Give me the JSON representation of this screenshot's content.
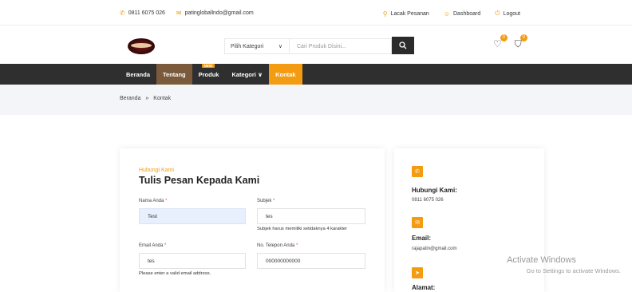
{
  "topbar": {
    "phone": "0811 6075 026",
    "email": "patingloballndo@gmail.com",
    "track": "Lacak Pesanan",
    "dashboard": "Dashboard",
    "logout": "Logout"
  },
  "header": {
    "category_label": "Pilih Kategori",
    "search_placeholder": "Cari Produk Disini...",
    "wishlist_count": "0",
    "cart_count": "0"
  },
  "nav": {
    "items": [
      "Beranda",
      "Tentang",
      "Produk",
      "Kategori ∨",
      "Kontak"
    ],
    "new_badge": "NEW"
  },
  "breadcrumb": {
    "home": "Beranda",
    "sep": "»",
    "current": "Kontak"
  },
  "form": {
    "subtitle": "Hubungi Kami",
    "title": "Tulis Pesan Kepada Kami",
    "name_label": "Nama Anda",
    "name_value": "Test",
    "subject_label": "Subjek",
    "subject_value": "tes",
    "subject_help": "Subjek harus memiliki setidaknya 4 karakter",
    "email_label": "Email Anda",
    "email_value": "tes",
    "email_help": "Please enter a valid email address.",
    "phone_label": "No. Telepon Anda",
    "phone_value": "000000000000",
    "required_mark": "*"
  },
  "info": {
    "phone_head": "Hubungi Kami:",
    "phone_val": "0811 6075 026",
    "email_head": "Email:",
    "email_val": "rajapatin@gmail.com",
    "address_head": "Alamat:"
  },
  "watermark": {
    "line1": "Activate Windows",
    "line2": "Go to Settings to activate Windows."
  },
  "colors": {
    "accent": "#f39c12",
    "nav_bg": "#2f2f2f",
    "tentang_bg": "#7a5a3a"
  }
}
